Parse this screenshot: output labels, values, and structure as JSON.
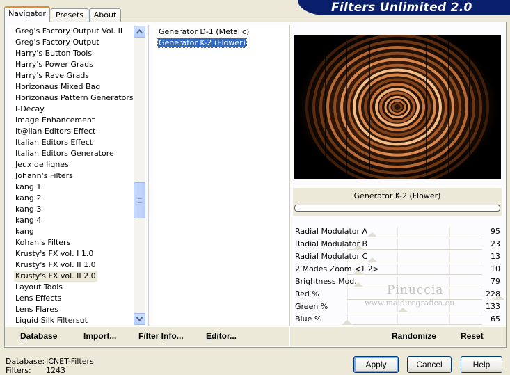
{
  "app": {
    "title": "Filters Unlimited 2.0"
  },
  "tabs": [
    {
      "label": "Navigator",
      "active": true
    },
    {
      "label": "Presets",
      "active": false
    },
    {
      "label": "About",
      "active": false
    }
  ],
  "categories": {
    "items": [
      "Greg's Factory Output Vol. II",
      "Greg's Factory Output",
      "Harry's Button Tools",
      "Harry's Power Grads",
      "Harry's Rave Grads",
      "Horizonaus Mixed Bag",
      "Horizonaus Pattern Generators",
      "I-Decay",
      "Image Enhancement",
      "It@lian Editors Effect",
      "Italian Editors Effect",
      "Italian Editors Generatore",
      "Jeux de lignes",
      "Johann's Filters",
      "kang 1",
      "kang 2",
      "kang 3",
      "kang 4",
      "kang",
      "Kohan's Filters",
      "Krusty's FX vol. I 1.0",
      "Krusty's FX vol. II 1.0",
      "Krusty's FX vol. II 2.0",
      "Layout Tools",
      "Lens Effects",
      "Lens Flares",
      "Liquid Silk Filtersut"
    ],
    "selected_index": 22
  },
  "filters": {
    "items": [
      "Generator D-1 (Metalic)",
      "Generator K-2 (Flower)"
    ],
    "selected_index": 1
  },
  "preview": {
    "filter_name": "Generator K-2 (Flower)",
    "progress": 0
  },
  "params": [
    {
      "label": "Radial Modulator A",
      "value": "95"
    },
    {
      "label": "Radial Modulator B",
      "value": "23"
    },
    {
      "label": "Radial Modulator C",
      "value": "13"
    },
    {
      "label": "2 Modes Zoom <1 2>",
      "value": "10"
    },
    {
      "label": "Brightness Mod.",
      "value": "79"
    },
    {
      "label": "Red %",
      "value": "228"
    },
    {
      "label": "Green %",
      "value": "133"
    },
    {
      "label": "Blue %",
      "value": "65"
    }
  ],
  "watermark": {
    "name": "Pinuccia",
    "url": "www.maidiregrafica.eu"
  },
  "buttons": {
    "database": {
      "label": "Database",
      "underline": "D",
      "rest": "atabase"
    },
    "import": {
      "label": "Import...",
      "pre": "Im",
      "underline": "p",
      "rest": "ort..."
    },
    "filter_info": {
      "label": "Filter Info...",
      "pre": "Filter ",
      "underline": "I",
      "rest": "nfo..."
    },
    "editor": {
      "label": "Editor...",
      "underline": "E",
      "rest": "ditor..."
    },
    "randomize": "Randomize",
    "reset": "Reset",
    "apply": "Apply",
    "cancel": "Cancel",
    "help": "Help"
  },
  "status": [
    {
      "label": "Database:",
      "value": "ICNET-Filters"
    },
    {
      "label": "Filters:",
      "value": "1243"
    }
  ],
  "colors": {
    "banner": "#0a1f6b",
    "selection": "#316ac5",
    "ring": "#c8743a"
  }
}
